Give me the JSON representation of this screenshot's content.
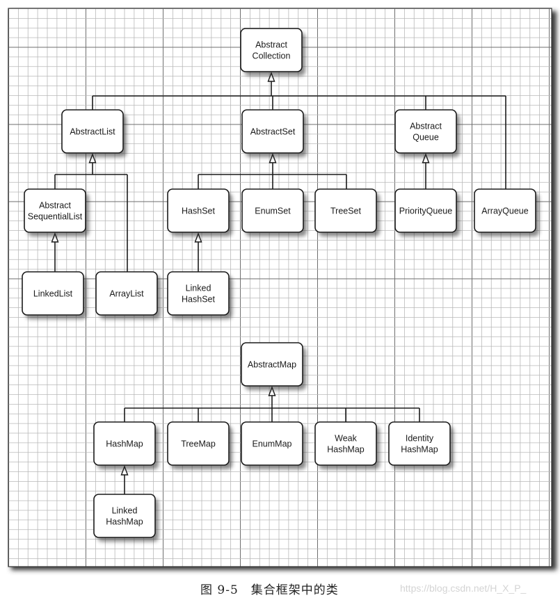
{
  "figure": {
    "caption": "图 9-5　集合框架中的类",
    "watermark": "https://blog.csdn.net/H_X_P_"
  },
  "colors": {
    "background": "#ffffff",
    "grid_minor": "#b8b8b8",
    "grid_major": "#6e6e6e",
    "box_fill": "#ffffff",
    "box_stroke": "#1a1a1a",
    "text": "#1a1a1a"
  },
  "diagram": {
    "type": "class-hierarchy",
    "relationship": "inheritance (hollow triangle arrow points to parent)",
    "nodes": [
      {
        "id": "AbstractCollection",
        "lines": [
          "Abstract",
          "Collection"
        ]
      },
      {
        "id": "AbstractList",
        "lines": [
          "AbstractList"
        ]
      },
      {
        "id": "AbstractSet",
        "lines": [
          "AbstractSet"
        ]
      },
      {
        "id": "AbstractQueue",
        "lines": [
          "Abstract",
          "Queue"
        ]
      },
      {
        "id": "AbstractSequentialList",
        "lines": [
          "Abstract",
          "SequentialList"
        ]
      },
      {
        "id": "HashSet",
        "lines": [
          "HashSet"
        ]
      },
      {
        "id": "EnumSet",
        "lines": [
          "EnumSet"
        ]
      },
      {
        "id": "TreeSet",
        "lines": [
          "TreeSet"
        ]
      },
      {
        "id": "PriorityQueue",
        "lines": [
          "PriorityQueue"
        ]
      },
      {
        "id": "ArrayQueue",
        "lines": [
          "ArrayQueue"
        ]
      },
      {
        "id": "LinkedList",
        "lines": [
          "LinkedList"
        ]
      },
      {
        "id": "ArrayList",
        "lines": [
          "ArrayList"
        ]
      },
      {
        "id": "LinkedHashSet",
        "lines": [
          "Linked",
          "HashSet"
        ]
      },
      {
        "id": "AbstractMap",
        "lines": [
          "AbstractMap"
        ]
      },
      {
        "id": "HashMap",
        "lines": [
          "HashMap"
        ]
      },
      {
        "id": "TreeMap",
        "lines": [
          "TreeMap"
        ]
      },
      {
        "id": "EnumMap",
        "lines": [
          "EnumMap"
        ]
      },
      {
        "id": "WeakHashMap",
        "lines": [
          "Weak",
          "HashMap"
        ]
      },
      {
        "id": "IdentityHashMap",
        "lines": [
          "Identity",
          "HashMap"
        ]
      },
      {
        "id": "LinkedHashMap",
        "lines": [
          "Linked",
          "HashMap"
        ]
      }
    ],
    "edges": [
      {
        "parent": "AbstractCollection",
        "children": [
          "AbstractList",
          "AbstractSet",
          "AbstractQueue",
          "ArrayQueue"
        ]
      },
      {
        "parent": "AbstractList",
        "children": [
          "AbstractSequentialList",
          "ArrayList"
        ]
      },
      {
        "parent": "AbstractSet",
        "children": [
          "HashSet",
          "EnumSet",
          "TreeSet"
        ]
      },
      {
        "parent": "AbstractQueue",
        "children": [
          "PriorityQueue"
        ]
      },
      {
        "parent": "AbstractSequentialList",
        "children": [
          "LinkedList"
        ]
      },
      {
        "parent": "HashSet",
        "children": [
          "LinkedHashSet"
        ]
      },
      {
        "parent": "AbstractMap",
        "children": [
          "HashMap",
          "TreeMap",
          "EnumMap",
          "WeakHashMap",
          "IdentityHashMap"
        ]
      },
      {
        "parent": "HashMap",
        "children": [
          "LinkedHashMap"
        ]
      }
    ]
  }
}
